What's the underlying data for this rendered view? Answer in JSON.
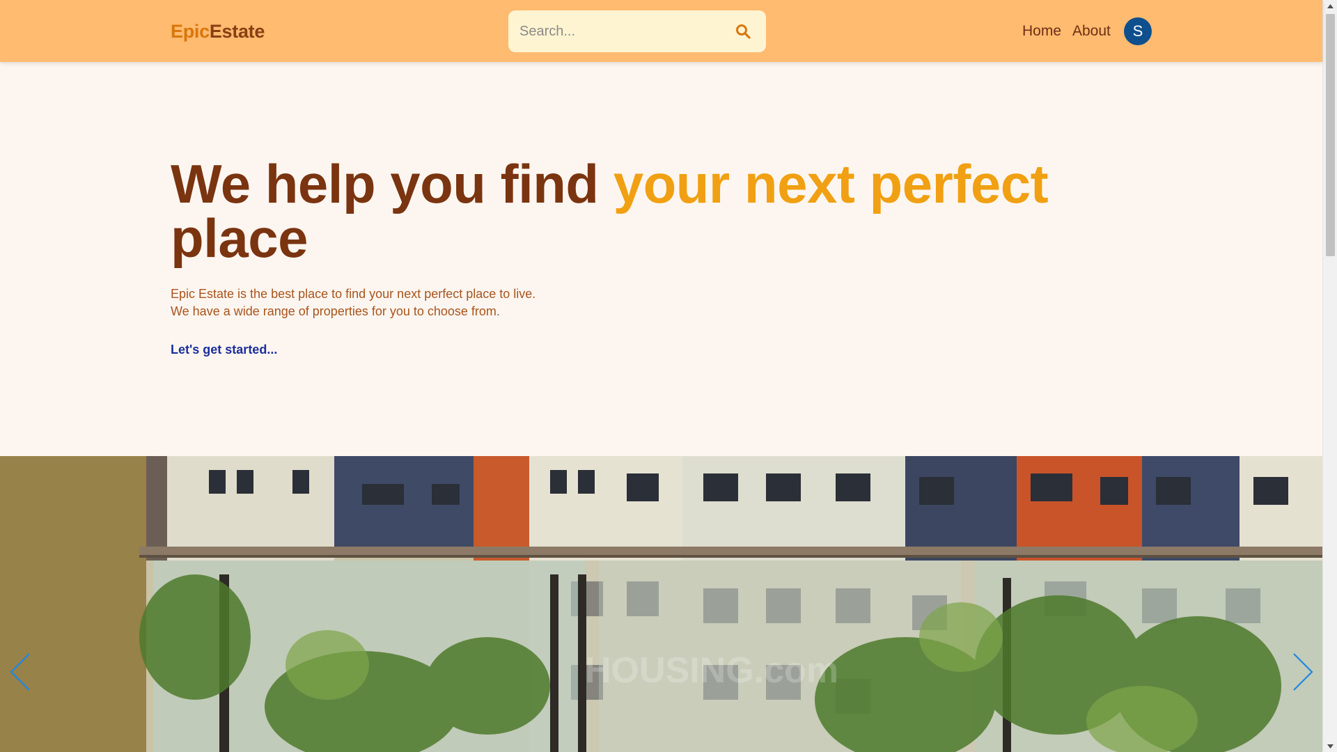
{
  "header": {
    "brand_part1": "Epic",
    "brand_part2": "Estate",
    "search_placeholder": "Search...",
    "nav_home": "Home",
    "nav_about": "About",
    "avatar_initial": "S"
  },
  "hero": {
    "title_main": "We help you find ",
    "title_accent": "your next perfect",
    "title_end": "place",
    "desc_line1": "Epic Estate is the best place to find your next perfect place to live.",
    "desc_line2": "We have a wide range of properties for you to choose from.",
    "cta": "Let's get started..."
  },
  "carousel": {
    "watermark": "HOUSING.com"
  },
  "colors": {
    "header_bg": "#ffbb70",
    "page_bg": "#fdf6f0",
    "brand_accent": "#d9770c",
    "brand_dark": "#8a3f12",
    "title_dark": "#7a3410",
    "title_accent": "#f0a012",
    "link_blue": "#1c2e9c",
    "avatar_bg": "#0f4f8e"
  }
}
